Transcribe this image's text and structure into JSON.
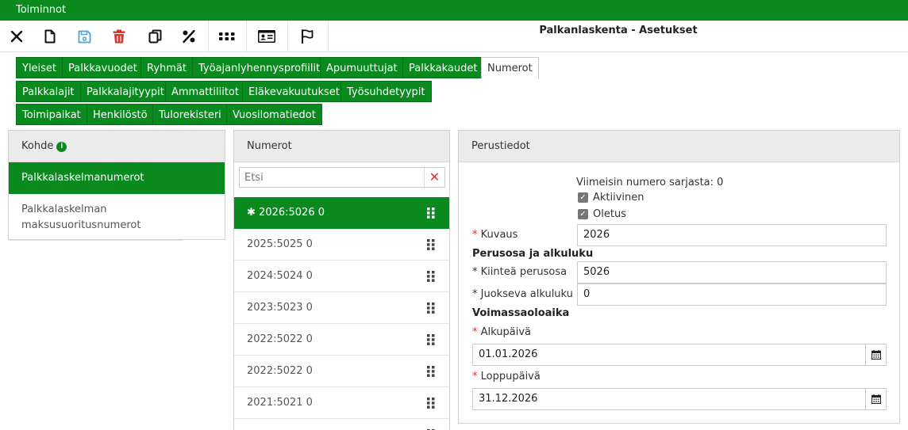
{
  "app": {
    "menu_label": "Toiminnot",
    "title": "Palkanlaskenta - Asetukset"
  },
  "toolbar": [
    {
      "icon": "close-icon"
    },
    {
      "icon": "new-document-icon"
    },
    {
      "icon": "save-icon"
    },
    {
      "icon": "delete-icon"
    },
    {
      "icon": "copy-icon"
    },
    {
      "icon": "percent-icon"
    },
    {
      "icon": "grid-dots-icon"
    },
    {
      "icon": "id-card-icon"
    },
    {
      "icon": "flag-icon"
    }
  ],
  "tabs": {
    "row1": [
      "Yleiset",
      "Palkkavuodet",
      "Ryhmät",
      "Työajanlyhennysprofiilit",
      "Apumuuttujat",
      "Palkkakaudet",
      "Numerot"
    ],
    "row2": [
      "Palkkalajit",
      "Palkkalajityypit",
      "Ammattiliitot",
      "Eläkevakuutukset",
      "Työsuhdetyypit"
    ],
    "row3": [
      "Toimipaikat",
      "Henkilöstö",
      "Tulorekisteri",
      "Vuosilomatiedot"
    ],
    "active": "Numerot"
  },
  "kohde": {
    "title": "Kohde",
    "items": [
      "Palkkalaskelmanumerot",
      "Palkkalaskelman maksusuoritusnumerot"
    ]
  },
  "numerot": {
    "title": "Numerot",
    "search_placeholder": "Etsi",
    "rows": [
      "2026:5026 0",
      "2025:5025 0",
      "2024:5024 0",
      "2023:5023 0",
      "2022:5022 0",
      "2022:5022 0",
      "2021:5021 0"
    ],
    "active_marker": "✱"
  },
  "perustiedot": {
    "title": "Perustiedot",
    "latest": "Viimeisin numero sarjasta: 0",
    "aktiivinen": "Aktiivinen",
    "oletus": "Oletus",
    "kuvaus_label": "Kuvaus",
    "kuvaus_value": "2026",
    "section1": "Perusosa ja alkuluku",
    "kiintea_label": "* Kiinteä perusosa",
    "kiintea_value": "5026",
    "juokseva_label": "* Juokseva alkuluku",
    "juokseva_value": "0",
    "section2": "Voimassaoloaika",
    "alku_label": "Alkupäivä",
    "alku_value": "01.01.2026",
    "loppu_label": "Loppupäivä",
    "loppu_value": "31.12.2026",
    "required_marker": "*"
  },
  "colors": {
    "brand": "#0a8a1e",
    "danger": "#d9342b",
    "save": "#4aa8d8"
  }
}
